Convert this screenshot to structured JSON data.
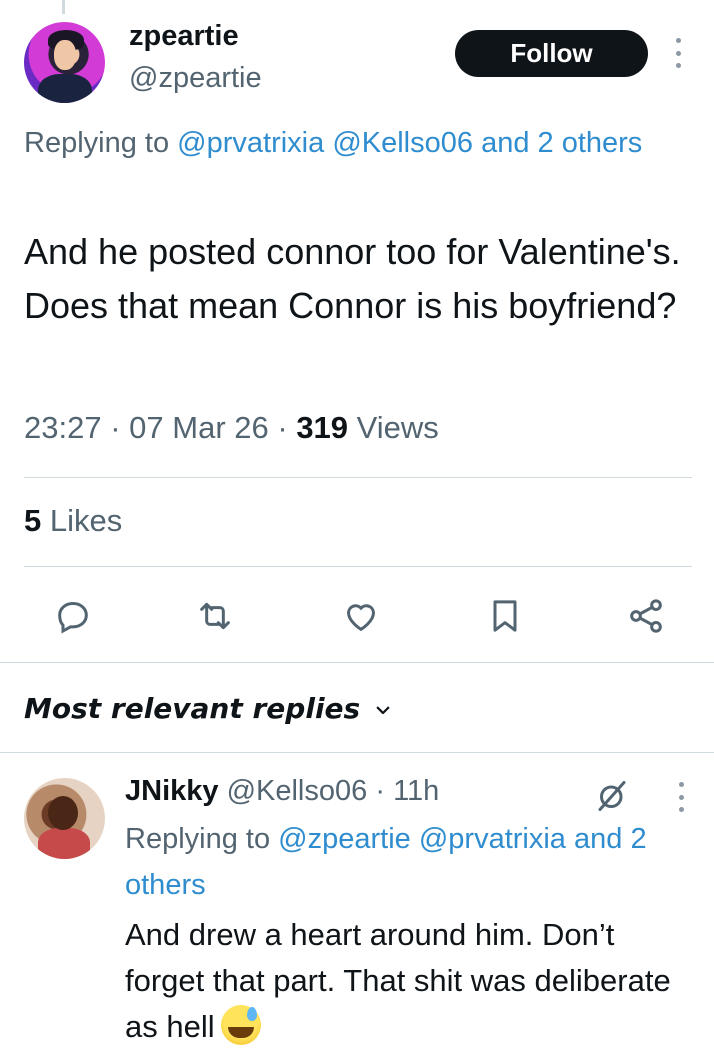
{
  "tweet": {
    "display_name": "zpeartie",
    "handle": "@zpeartie",
    "follow_label": "Follow",
    "replying_prefix": "Replying to ",
    "replying_mention_1": "@prvatrixia",
    "replying_mention_2": "@Kellso06",
    "replying_others": "and 2 others",
    "text": "And he posted connor too for Valentine's. Does that mean Connor is his boyfriend?",
    "time": "23:27",
    "date": "07 Mar 26",
    "views_count": "319",
    "views_label": "Views",
    "sep": "·",
    "likes_count": "5",
    "likes_label": "Likes"
  },
  "actions": {
    "icons": [
      "reply-icon",
      "retweet-icon",
      "like-icon",
      "bookmark-icon",
      "share-icon"
    ]
  },
  "replies_header": {
    "label": "Most relevant replies"
  },
  "reply": {
    "display_name": "JNikky",
    "handle": "@Kellso06",
    "time": "11h",
    "sep": "·",
    "replying_prefix": "Replying to ",
    "replying_mention_1": "@zpeartie",
    "replying_mention_2": "@prvatrixia",
    "replying_others": "and 2 others",
    "text": "And drew a heart around him. Don’t forget that part. That shit was deliberate as hell"
  },
  "colors": {
    "text": "#0f1419",
    "secondary": "#536471",
    "link": "#2f8dcf",
    "divider": "#cfd9de",
    "button": "#0f1419"
  }
}
